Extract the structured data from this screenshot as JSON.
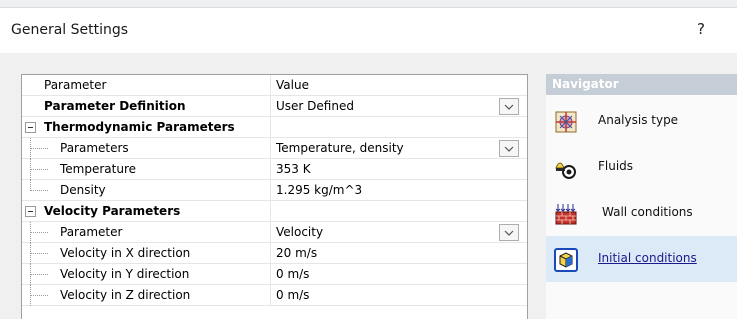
{
  "window": {
    "title": "General Settings",
    "help_label": "?"
  },
  "grid": {
    "columns": [
      "Parameter",
      "Value"
    ],
    "rows": [
      {
        "name": "Parameter Definition",
        "value": "User Defined"
      },
      {
        "name": "Thermodynamic Parameters",
        "value": ""
      },
      {
        "name": "Parameters",
        "value": "Temperature, density"
      },
      {
        "name": "Temperature",
        "value": "353 K"
      },
      {
        "name": "Density",
        "value": "1.295 kg/m^3"
      },
      {
        "name": "Velocity Parameters",
        "value": ""
      },
      {
        "name": "Parameter",
        "value": "Velocity"
      },
      {
        "name": "Velocity in X direction",
        "value": "20 m/s"
      },
      {
        "name": "Velocity in Y direction",
        "value": "0 m/s"
      },
      {
        "name": "Velocity in Z direction",
        "value": "0 m/s"
      }
    ]
  },
  "navigator": {
    "header": "Navigator",
    "items": [
      {
        "label": "Analysis type",
        "icon": "analysis-type-icon"
      },
      {
        "label": "Fluids",
        "icon": "fluids-icon"
      },
      {
        "label": "Wall conditions",
        "icon": "wall-conditions-icon"
      },
      {
        "label": "Initial conditions",
        "icon": "initial-conditions-icon"
      }
    ]
  },
  "colors": {
    "nav_header": "#c5cdd6",
    "nav_active": "#dce9f7",
    "link": "#1a1a8c"
  }
}
